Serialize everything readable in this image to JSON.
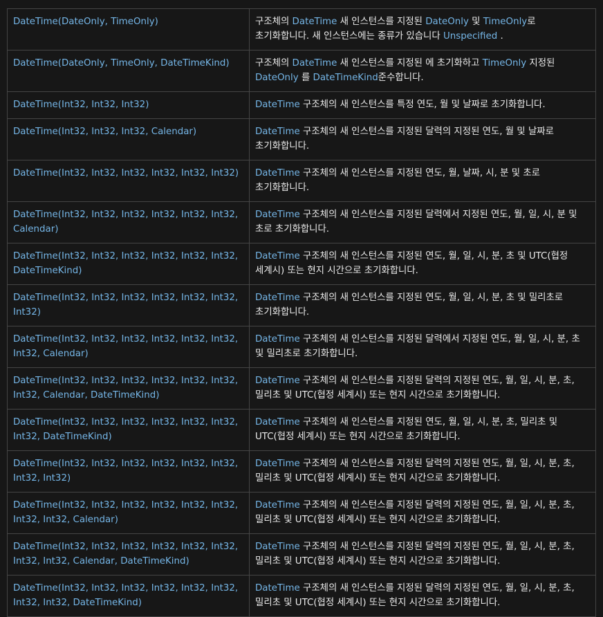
{
  "rows": [
    {
      "ctor": "DateTime(DateOnly, TimeOnly)",
      "desc": [
        {
          "t": "구조체의 "
        },
        {
          "t": "DateTime",
          "l": 1
        },
        {
          "t": " 새 인스턴스를 지정된 "
        },
        {
          "t": "DateOnly",
          "l": 1
        },
        {
          "t": " 및 "
        },
        {
          "t": "TimeOnly",
          "l": 1
        },
        {
          "t": "로 초기화합니다. 새 인스턴스에는 종류가 있습니다 "
        },
        {
          "t": "Unspecified",
          "l": 1
        },
        {
          "t": " ."
        }
      ]
    },
    {
      "ctor": "DateTime(DateOnly, TimeOnly, DateTimeKind)",
      "desc": [
        {
          "t": "구조체의 "
        },
        {
          "t": "DateTime",
          "l": 1
        },
        {
          "t": " 새 인스턴스를 지정된 에 초기화하고 "
        },
        {
          "t": "TimeOnly",
          "l": 1
        },
        {
          "t": " 지정된 "
        },
        {
          "t": "DateOnly",
          "l": 1
        },
        {
          "t": " 를 "
        },
        {
          "t": "DateTimeKind",
          "l": 1
        },
        {
          "t": "준수합니다."
        }
      ]
    },
    {
      "ctor": "DateTime(Int32, Int32, Int32)",
      "desc": [
        {
          "t": "DateTime",
          "l": 1
        },
        {
          "t": " 구조체의 새 인스턴스를 특정 연도, 월 및 날짜로 초기화합니다."
        }
      ]
    },
    {
      "ctor": "DateTime(Int32, Int32, Int32, Calendar)",
      "desc": [
        {
          "t": "DateTime",
          "l": 1
        },
        {
          "t": " 구조체의 새 인스턴스를 지정된 달력의 지정된 연도, 월 및 날짜로 초기화합니다."
        }
      ]
    },
    {
      "ctor": "DateTime(Int32, Int32, Int32, Int32, Int32, Int32)",
      "desc": [
        {
          "t": "DateTime",
          "l": 1
        },
        {
          "t": " 구조체의 새 인스턴스를 지정된 연도, 월, 날짜, 시, 분 및 초로 초기화합니다."
        }
      ]
    },
    {
      "ctor": "DateTime(Int32, Int32, Int32, Int32, Int32, Int32, Calendar)",
      "desc": [
        {
          "t": "DateTime",
          "l": 1
        },
        {
          "t": " 구조체의 새 인스턴스를 지정된 달력에서 지정된 연도, 월, 일, 시, 분 및 초로 초기화합니다."
        }
      ]
    },
    {
      "ctor": "DateTime(Int32, Int32, Int32, Int32, Int32, Int32, DateTimeKind)",
      "desc": [
        {
          "t": "DateTime",
          "l": 1
        },
        {
          "t": " 구조체의 새 인스턴스를 지정된 연도, 월, 일, 시, 분, 초 및 UTC(협정 세계시) 또는 현지 시간으로 초기화합니다."
        }
      ]
    },
    {
      "ctor": "DateTime(Int32, Int32, Int32, Int32, Int32, Int32, Int32)",
      "desc": [
        {
          "t": "DateTime",
          "l": 1
        },
        {
          "t": " 구조체의 새 인스턴스를 지정된 연도, 월, 일, 시, 분, 초 및 밀리초로 초기화합니다."
        }
      ]
    },
    {
      "ctor": "DateTime(Int32, Int32, Int32, Int32, Int32, Int32, Int32, Calendar)",
      "desc": [
        {
          "t": "DateTime",
          "l": 1
        },
        {
          "t": " 구조체의 새 인스턴스를 지정된 달력에서 지정된 연도, 월, 일, 시, 분, 초 및 밀리초로 초기화합니다."
        }
      ]
    },
    {
      "ctor": "DateTime(Int32, Int32, Int32, Int32, Int32, Int32, Int32, Calendar, DateTimeKind)",
      "desc": [
        {
          "t": "DateTime",
          "l": 1
        },
        {
          "t": " 구조체의 새 인스턴스를 지정된 달력의 지정된 연도, 월, 일, 시, 분, 초, 밀리초 및 UTC(협정 세계시) 또는 현지 시간으로 초기화합니다."
        }
      ]
    },
    {
      "ctor": "DateTime(Int32, Int32, Int32, Int32, Int32, Int32, Int32, DateTimeKind)",
      "desc": [
        {
          "t": "DateTime",
          "l": 1
        },
        {
          "t": " 구조체의 새 인스턴스를 지정된 연도, 월, 일, 시, 분, 초, 밀리초 및 UTC(협정 세계시) 또는 현지 시간으로 초기화합니다."
        }
      ]
    },
    {
      "ctor": "DateTime(Int32, Int32, Int32, Int32, Int32, Int32, Int32, Int32)",
      "desc": [
        {
          "t": "DateTime",
          "l": 1
        },
        {
          "t": " 구조체의 새 인스턴스를 지정된 달력의 지정된 연도, 월, 일, 시, 분, 초, 밀리초 및 UTC(협정 세계시) 또는 현지 시간으로 초기화합니다."
        }
      ]
    },
    {
      "ctor": "DateTime(Int32, Int32, Int32, Int32, Int32, Int32, Int32, Int32, Calendar)",
      "desc": [
        {
          "t": "DateTime",
          "l": 1
        },
        {
          "t": " 구조체의 새 인스턴스를 지정된 달력의 지정된 연도, 월, 일, 시, 분, 초, 밀리초 및 UTC(협정 세계시) 또는 현지 시간으로 초기화합니다."
        }
      ]
    },
    {
      "ctor": "DateTime(Int32, Int32, Int32, Int32, Int32, Int32, Int32, Int32, Calendar, DateTimeKind)",
      "desc": [
        {
          "t": "DateTime",
          "l": 1
        },
        {
          "t": " 구조체의 새 인스턴스를 지정된 달력의 지정된 연도, 월, 일, 시, 분, 초, 밀리초 및 UTC(협정 세계시) 또는 현지 시간으로 초기화합니다."
        }
      ]
    },
    {
      "ctor": "DateTime(Int32, Int32, Int32, Int32, Int32, Int32, Int32, Int32, DateTimeKind)",
      "desc": [
        {
          "t": "DateTime",
          "l": 1
        },
        {
          "t": " 구조체의 새 인스턴스를 지정된 달력의 지정된 연도, 월, 일, 시, 분, 초, 밀리초 및 UTC(협정 세계시) 또는 현지 시간으로 초기화합니다."
        }
      ]
    }
  ]
}
